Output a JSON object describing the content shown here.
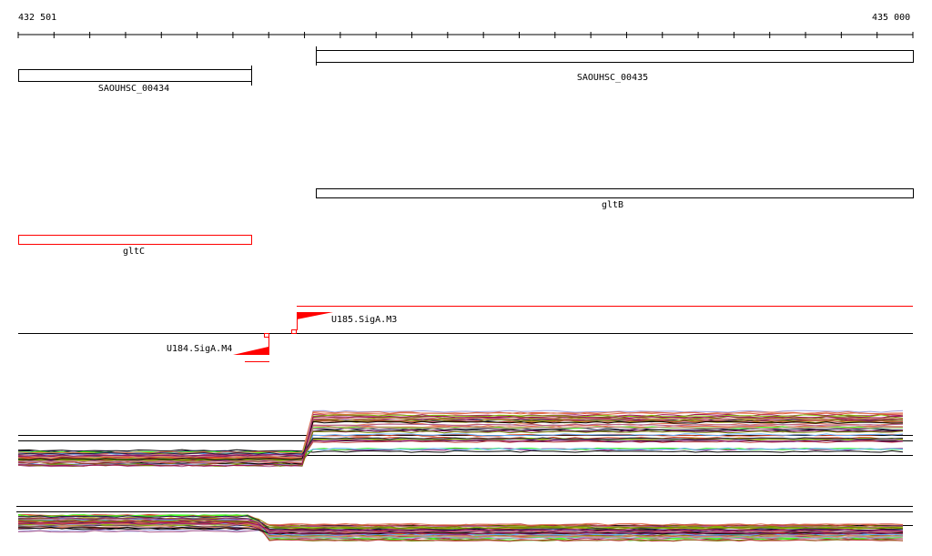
{
  "ruler": {
    "start_label": "432 501",
    "end_label": "435 000",
    "tick_count": 25
  },
  "genes": [
    {
      "name": "SAOUHSC_00434",
      "strand": "-",
      "color": "#000000"
    },
    {
      "name": "SAOUHSC_00435",
      "strand": "+",
      "color": "#000000"
    },
    {
      "name": "gltB",
      "strand": "+",
      "color": "#000000"
    },
    {
      "name": "gltC",
      "strand": "-",
      "color": "#ff0000"
    }
  ],
  "promoters": [
    {
      "name": "U185.SigA.M3",
      "strand": "+",
      "color": "#ff0000"
    },
    {
      "name": "U184.SigA.M4",
      "strand": "-",
      "color": "#ff0000"
    }
  ],
  "expression": {
    "palette": [
      "#000000",
      "#1a1a4a",
      "#8b1a6b",
      "#a0105a",
      "#d04020",
      "#e06040",
      "#8b8b00",
      "#a0a000",
      "#80c000",
      "#40ff20",
      "#60b0ff",
      "#a0a0e0",
      "#d09070",
      "#c04040",
      "#b06090",
      "#708000",
      "#e07050",
      "#c08080"
    ],
    "profile_count": 40
  }
}
